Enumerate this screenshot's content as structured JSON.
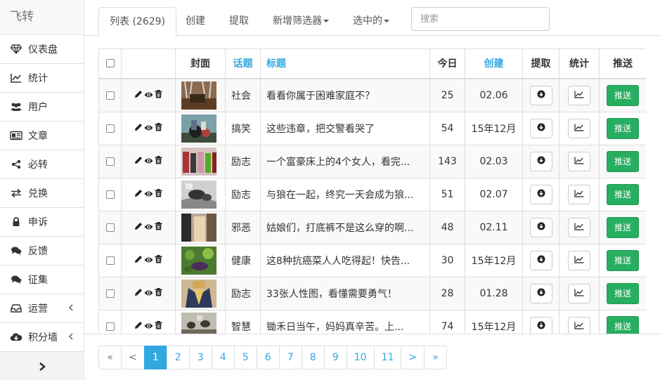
{
  "brand": "飞转",
  "sidebar": {
    "items": [
      {
        "label": "仪表盘",
        "icon": "diamond-icon",
        "name": "dashboard"
      },
      {
        "label": "统计",
        "icon": "line-chart-icon",
        "name": "stats"
      },
      {
        "label": "用户",
        "icon": "users-icon",
        "name": "users"
      },
      {
        "label": "文章",
        "icon": "newspaper-icon",
        "name": "articles"
      },
      {
        "label": "必转",
        "icon": "share-icon",
        "name": "must-share"
      },
      {
        "label": "兑换",
        "icon": "exchange-icon",
        "name": "exchange"
      },
      {
        "label": "申诉",
        "icon": "lock-icon",
        "name": "appeal"
      },
      {
        "label": "反馈",
        "icon": "comments-icon",
        "name": "feedback"
      },
      {
        "label": "征集",
        "icon": "comments-icon",
        "name": "collect"
      },
      {
        "label": "运营",
        "icon": "inbox-icon",
        "name": "operations",
        "has_chevron": true
      },
      {
        "label": "积分墙",
        "icon": "cloud-download-icon",
        "name": "points-wall",
        "has_chevron": true
      }
    ]
  },
  "tabs": {
    "list": "列表 (2629)",
    "create": "创建",
    "extract": "提取",
    "add_filter": "新增筛选器",
    "selected": "选中的"
  },
  "search": {
    "placeholder": "搜索",
    "value": ""
  },
  "table": {
    "headers": {
      "cover": "封面",
      "topic": "话题",
      "title": "标题",
      "today": "今日",
      "created": "创建",
      "extract": "提取",
      "stats": "统计",
      "push": "推送"
    },
    "push_label": "推送",
    "rows": [
      {
        "topic": "社会",
        "title": "看看你属于困难家庭不？",
        "today": "25",
        "created": "02.06"
      },
      {
        "topic": "搞笑",
        "title": "这些违章，把交警看哭了",
        "today": "54",
        "created": "15年12月"
      },
      {
        "topic": "励志",
        "title": "一个富豪床上的4个女人，看完...",
        "today": "143",
        "created": "02.03"
      },
      {
        "topic": "励志",
        "title": "与狼在一起，终究一天会成为狼...",
        "today": "51",
        "created": "02.07"
      },
      {
        "topic": "邪恶",
        "title": "姑娘们，打底裤不是这么穿的啊...",
        "today": "48",
        "created": "02.11"
      },
      {
        "topic": "健康",
        "title": "这8种抗癌菜人人吃得起！快告...",
        "today": "30",
        "created": "15年12月"
      },
      {
        "topic": "励志",
        "title": "33张人性图，看懂需要勇气！",
        "today": "28",
        "created": "01.28"
      },
      {
        "topic": "智慧",
        "title": " 锄禾日当午，妈妈真辛苦。上...",
        "today": "74",
        "created": "15年12月"
      }
    ]
  },
  "pagination": {
    "first": "«",
    "prev": "<",
    "pages": [
      "1",
      "2",
      "3",
      "4",
      "5",
      "6",
      "7",
      "8",
      "9",
      "10",
      "11"
    ],
    "active": "1",
    "next": ">",
    "last": "»"
  },
  "colors": {
    "accent": "#31a8e0",
    "push_button": "#27ae60"
  }
}
